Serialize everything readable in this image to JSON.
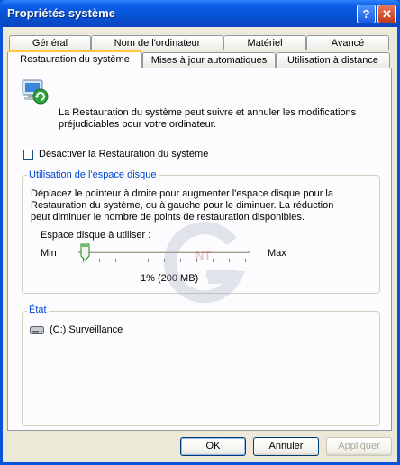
{
  "window": {
    "title": "Propriétés système",
    "help_glyph": "?",
    "close_glyph": "✕"
  },
  "tabs_row1": [
    "Général",
    "Nom de l'ordinateur",
    "Matériel",
    "Avancé"
  ],
  "tabs_row2": [
    "Restauration du système",
    "Mises à jour automatiques",
    "Utilisation à distance"
  ],
  "active_tab": "Restauration du système",
  "intro": {
    "line1": "La Restauration du système peut suivre et annuler les modifications",
    "line2": "préjudiciables pour votre ordinateur."
  },
  "disable_checkbox": {
    "label": "Désactiver la Restauration du système",
    "checked": false
  },
  "disk_group": {
    "legend": "Utilisation de l'espace disque",
    "desc_line1": "Déplacez le pointeur à droite pour augmenter l'espace disque pour la",
    "desc_line2": "Restauration du système, ou à gauche pour le diminuer. La réduction",
    "desc_line3": "peut diminuer le nombre de points de restauration disponibles.",
    "slider_label": "Espace disque à utiliser :",
    "min_label": "Min",
    "max_label": "Max",
    "value_text": "1% (200 MB)",
    "value_fraction": 0.01
  },
  "state_group": {
    "legend": "État",
    "drives": [
      {
        "label": "(C:) Surveillance"
      }
    ]
  },
  "watermark": {
    "text": "NT"
  },
  "buttons": {
    "ok": "OK",
    "cancel": "Annuler",
    "apply": "Appliquer"
  }
}
